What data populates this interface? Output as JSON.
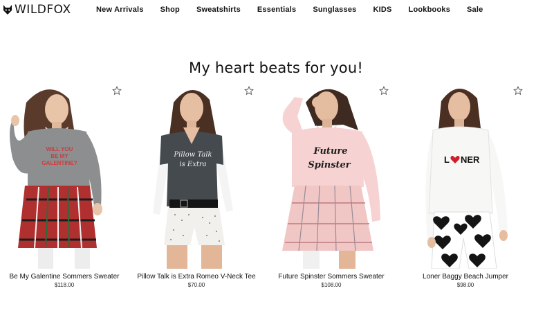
{
  "brand": {
    "name": "WILDFOX"
  },
  "nav": [
    {
      "label": "New Arrivals"
    },
    {
      "label": "Shop"
    },
    {
      "label": "Sweatshirts"
    },
    {
      "label": "Essentials"
    },
    {
      "label": "Sunglasses"
    },
    {
      "label": "KIDS"
    },
    {
      "label": "Lookbooks"
    },
    {
      "label": "Sale"
    }
  ],
  "heading": "My heart beats for you!",
  "products": [
    {
      "name": "Be My Galentine Sommers Sweater",
      "price": "$118.00",
      "shirt_text_1": "WILL YOU",
      "shirt_text_2": "BE MY",
      "shirt_text_3": "GALENTINE?"
    },
    {
      "name": "Pillow Talk is Extra Romeo V-Neck Tee",
      "price": "$70.00",
      "shirt_text_1": "Pillow Talk",
      "shirt_text_2": "is Extra"
    },
    {
      "name": "Future Spinster Sommers Sweater",
      "price": "$108.00",
      "shirt_text_1": "Future",
      "shirt_text_2": "Spinster"
    },
    {
      "name": "Loner Baggy Beach Jumper",
      "price": "$98.00",
      "shirt_text_1": "L",
      "shirt_text_2": "NER"
    }
  ],
  "icons": {
    "favorite": "star-outline-icon"
  }
}
